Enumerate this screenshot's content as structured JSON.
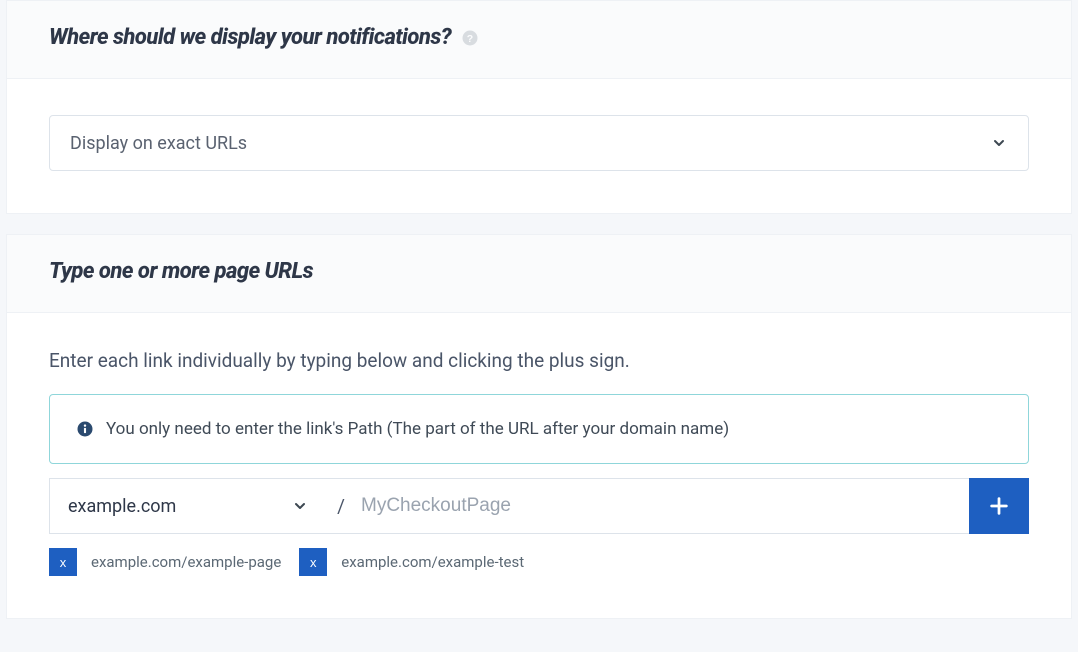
{
  "section1": {
    "title": "Where should we display your notifications?",
    "select_value": "Display on exact URLs"
  },
  "section2": {
    "title": "Type one or more page URLs",
    "instruction": "Enter each link individually by typing below and clicking the plus sign.",
    "info_text": "You only need to enter the link's Path (The part of the URL after your domain name)",
    "domain_value": "example.com",
    "slash": "/",
    "path_placeholder": "MyCheckoutPage",
    "tags": [
      {
        "remove": "x",
        "label": "example.com/example-page"
      },
      {
        "remove": "x",
        "label": "example.com/example-test"
      }
    ]
  }
}
